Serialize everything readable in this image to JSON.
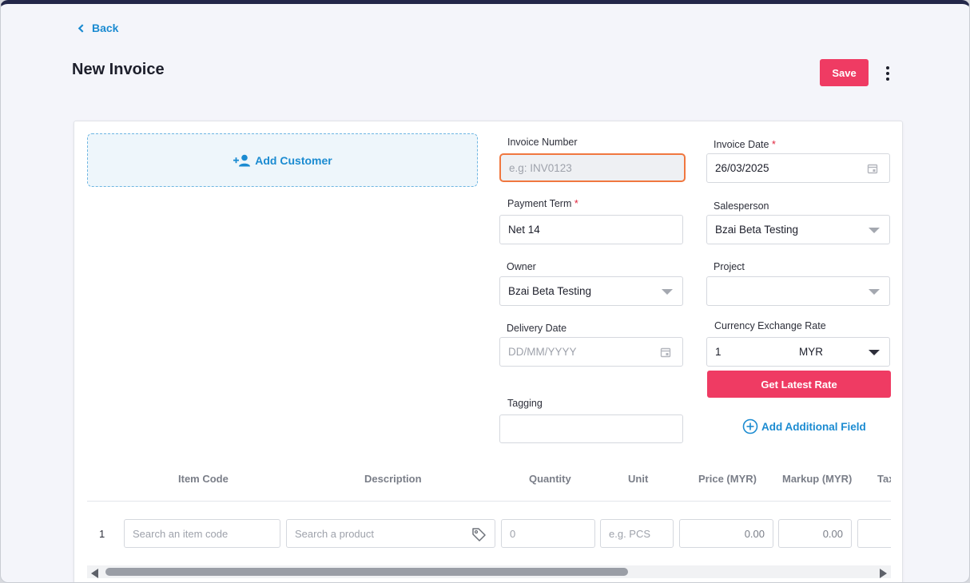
{
  "header": {
    "back_label": "Back",
    "title": "New Invoice",
    "save_label": "Save"
  },
  "customer": {
    "add_label": "Add Customer"
  },
  "form": {
    "invoice_number": {
      "label": "Invoice Number",
      "placeholder": "e.g: INV0123"
    },
    "invoice_date": {
      "label": "Invoice Date",
      "value": "26/03/2025"
    },
    "payment_term": {
      "label": "Payment Term",
      "value": "Net 14"
    },
    "salesperson": {
      "label": "Salesperson",
      "value": "Bzai Beta Testing"
    },
    "owner": {
      "label": "Owner",
      "value": "Bzai Beta Testing"
    },
    "project": {
      "label": "Project",
      "value": ""
    },
    "delivery_date": {
      "label": "Delivery Date",
      "placeholder": "DD/MM/YYYY"
    },
    "currency": {
      "label": "Currency Exchange Rate",
      "rate": "1",
      "code": "MYR"
    },
    "get_rate_label": "Get Latest Rate",
    "tagging": {
      "label": "Tagging",
      "value": ""
    },
    "add_field_label": "Add Additional Field",
    "required_mark": "*"
  },
  "items_table": {
    "columns": [
      "Item Code",
      "Description",
      "Quantity",
      "Unit",
      "Price (MYR)",
      "Markup (MYR)",
      "Tax"
    ],
    "rows": [
      {
        "index": "1",
        "item_code_placeholder": "Search an item code",
        "description_placeholder": "Search a product",
        "quantity": "0",
        "unit_placeholder": "e.g. PCS",
        "price": "0.00",
        "markup": "0.00"
      }
    ]
  },
  "colors": {
    "accent": "#ef3b63",
    "link": "#1b8bd1",
    "focus_border": "#f0773f",
    "top_bar": "#232749"
  },
  "icons": [
    "back-chevron-icon",
    "more-vertical-icon",
    "add-person-icon",
    "calendar-icon",
    "chevron-down-icon",
    "add-circle-icon",
    "tag-icon"
  ]
}
